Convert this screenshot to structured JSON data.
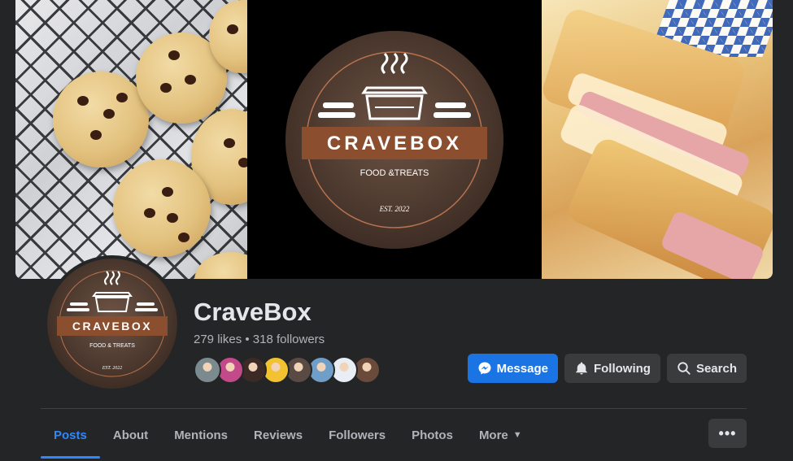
{
  "cover": {
    "logo": {
      "brand": "CRAVEBOX",
      "tagline": "FOOD &TREATS",
      "est": "EST. 2022"
    }
  },
  "profile": {
    "logo": {
      "brand": "CRAVEBOX",
      "tagline": "FOOD & TREATS",
      "est": "EST. 2022"
    },
    "name": "CraveBox",
    "stats": "279 likes • 318 followers"
  },
  "friends": [
    {
      "color": "#7a8a8e"
    },
    {
      "color": "#c24a8a"
    },
    {
      "color": "#3b2a25"
    },
    {
      "color": "#f2c230"
    },
    {
      "color": "#5a4a44"
    },
    {
      "color": "#6f9fc9"
    },
    {
      "color": "#e8eef3"
    },
    {
      "color": "#6a4a3a"
    }
  ],
  "actions": {
    "message": "Message",
    "following": "Following",
    "search": "Search"
  },
  "tabs": [
    {
      "label": "Posts"
    },
    {
      "label": "About"
    },
    {
      "label": "Mentions"
    },
    {
      "label": "Reviews"
    },
    {
      "label": "Followers"
    },
    {
      "label": "Photos"
    },
    {
      "label": "More"
    }
  ],
  "more_button": "•••",
  "colors": {
    "background": "#242526",
    "accent": "#1b74e4",
    "active_tab": "#2d88ff",
    "brand_brown": "#8b4e2e"
  }
}
